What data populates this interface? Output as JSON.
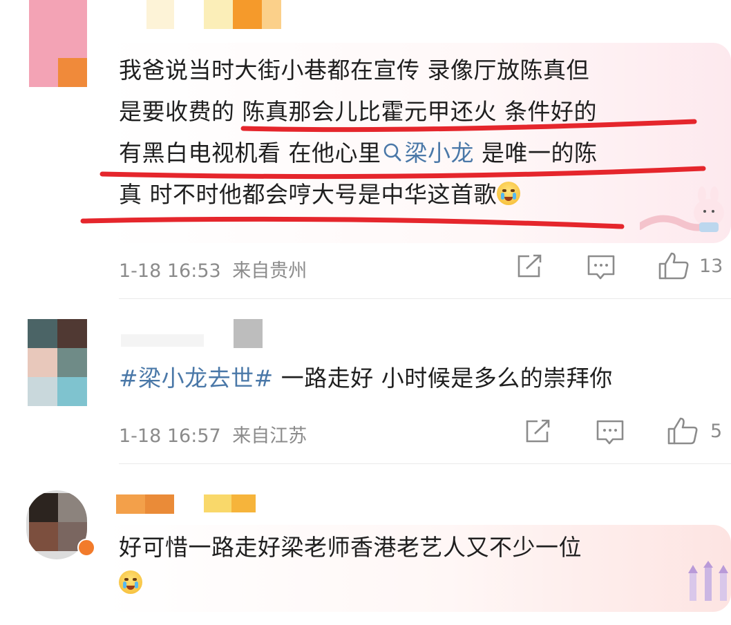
{
  "comments": [
    {
      "lines": [
        "我爸说当时大街小巷都在宣传 录像厅放陈真但",
        "是要收费的 陈真那会儿比霍元甲还火 条件好的"
      ],
      "line3_prefix": "有黑白电视机看 在他心里",
      "link_text": "梁小龙",
      "line3_suffix": " 是唯一的陈",
      "line4": "真 时不时他都会哼大号是中华这首歌",
      "emoji": "crying-emoji",
      "time": "1-18 16:53",
      "location": "来自贵州",
      "likes": "13"
    },
    {
      "hashtag": "#梁小龙去世#",
      "text": " 一路走好 小时候是多么的崇拜你",
      "time": "1-18 16:57",
      "location": "来自江苏",
      "likes": "5"
    },
    {
      "text": "好可惜一路走好梁老师香港老艺人又不少一位",
      "emoji": "crying-emoji"
    }
  ],
  "icons": {
    "share": "share-icon",
    "comment": "comment-icon",
    "like": "thumbs-up-icon",
    "search": "search-icon"
  },
  "colors": {
    "link": "#4a78a8",
    "underline": "#e5262c",
    "meta": "#8b8b8b"
  }
}
